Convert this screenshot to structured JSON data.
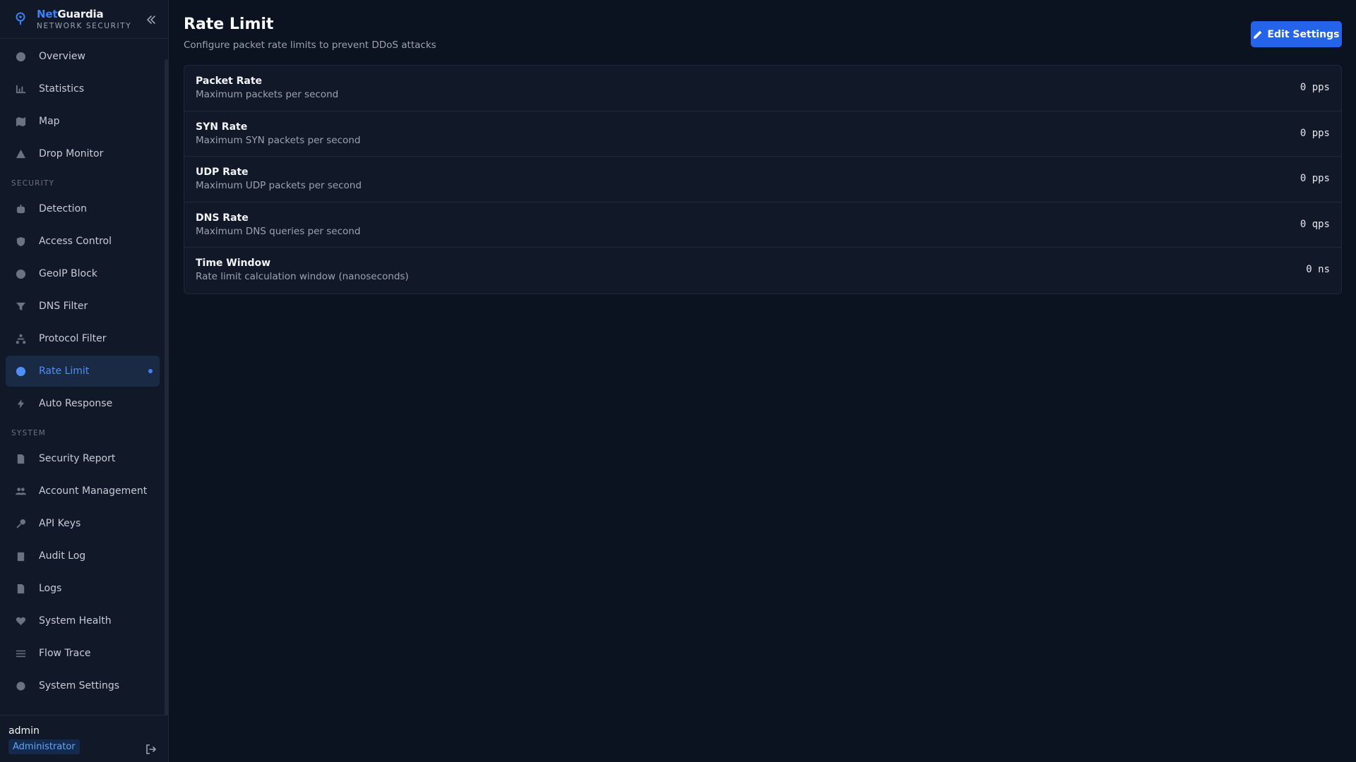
{
  "brand": {
    "name_part1": "Net",
    "name_part2": "Guardia",
    "subtitle": "NETWORK SECURITY",
    "accent_color": "#3b82f6"
  },
  "nav": {
    "main": [
      {
        "label": "Overview",
        "icon": "dashboard-icon"
      },
      {
        "label": "Statistics",
        "icon": "chart-icon"
      },
      {
        "label": "Map",
        "icon": "map-icon"
      },
      {
        "label": "Drop Monitor",
        "icon": "warning-icon"
      }
    ],
    "security_label": "SECURITY",
    "security": [
      {
        "label": "Detection",
        "icon": "robot-icon"
      },
      {
        "label": "Access Control",
        "icon": "shield-icon"
      },
      {
        "label": "GeoIP Block",
        "icon": "globe-icon"
      },
      {
        "label": "DNS Filter",
        "icon": "filter-icon"
      },
      {
        "label": "Protocol Filter",
        "icon": "sitemap-icon"
      },
      {
        "label": "Rate Limit",
        "icon": "gauge-icon",
        "active": true
      },
      {
        "label": "Auto Response",
        "icon": "bolt-icon"
      }
    ],
    "system_label": "SYSTEM",
    "system": [
      {
        "label": "Security Report",
        "icon": "document-icon"
      },
      {
        "label": "Account Management",
        "icon": "users-icon"
      },
      {
        "label": "API Keys",
        "icon": "key-icon"
      },
      {
        "label": "Audit Log",
        "icon": "clipboard-icon"
      },
      {
        "label": "Logs",
        "icon": "file-icon"
      },
      {
        "label": "System Health",
        "icon": "heart-icon"
      },
      {
        "label": "Flow Trace",
        "icon": "list-icon"
      },
      {
        "label": "System Settings",
        "icon": "gear-icon"
      }
    ]
  },
  "user": {
    "name": "admin",
    "role": "Administrator"
  },
  "page": {
    "title": "Rate Limit",
    "subtitle": "Configure packet rate limits to prevent DDoS attacks",
    "edit_button": "Edit Settings"
  },
  "settings": [
    {
      "label": "Packet Rate",
      "description": "Maximum packets per second",
      "value": "0 pps"
    },
    {
      "label": "SYN Rate",
      "description": "Maximum SYN packets per second",
      "value": "0 pps"
    },
    {
      "label": "UDP Rate",
      "description": "Maximum UDP packets per second",
      "value": "0 pps"
    },
    {
      "label": "DNS Rate",
      "description": "Maximum DNS queries per second",
      "value": "0 qps"
    },
    {
      "label": "Time Window",
      "description": "Rate limit calculation window (nanoseconds)",
      "value": "0 ns"
    }
  ]
}
